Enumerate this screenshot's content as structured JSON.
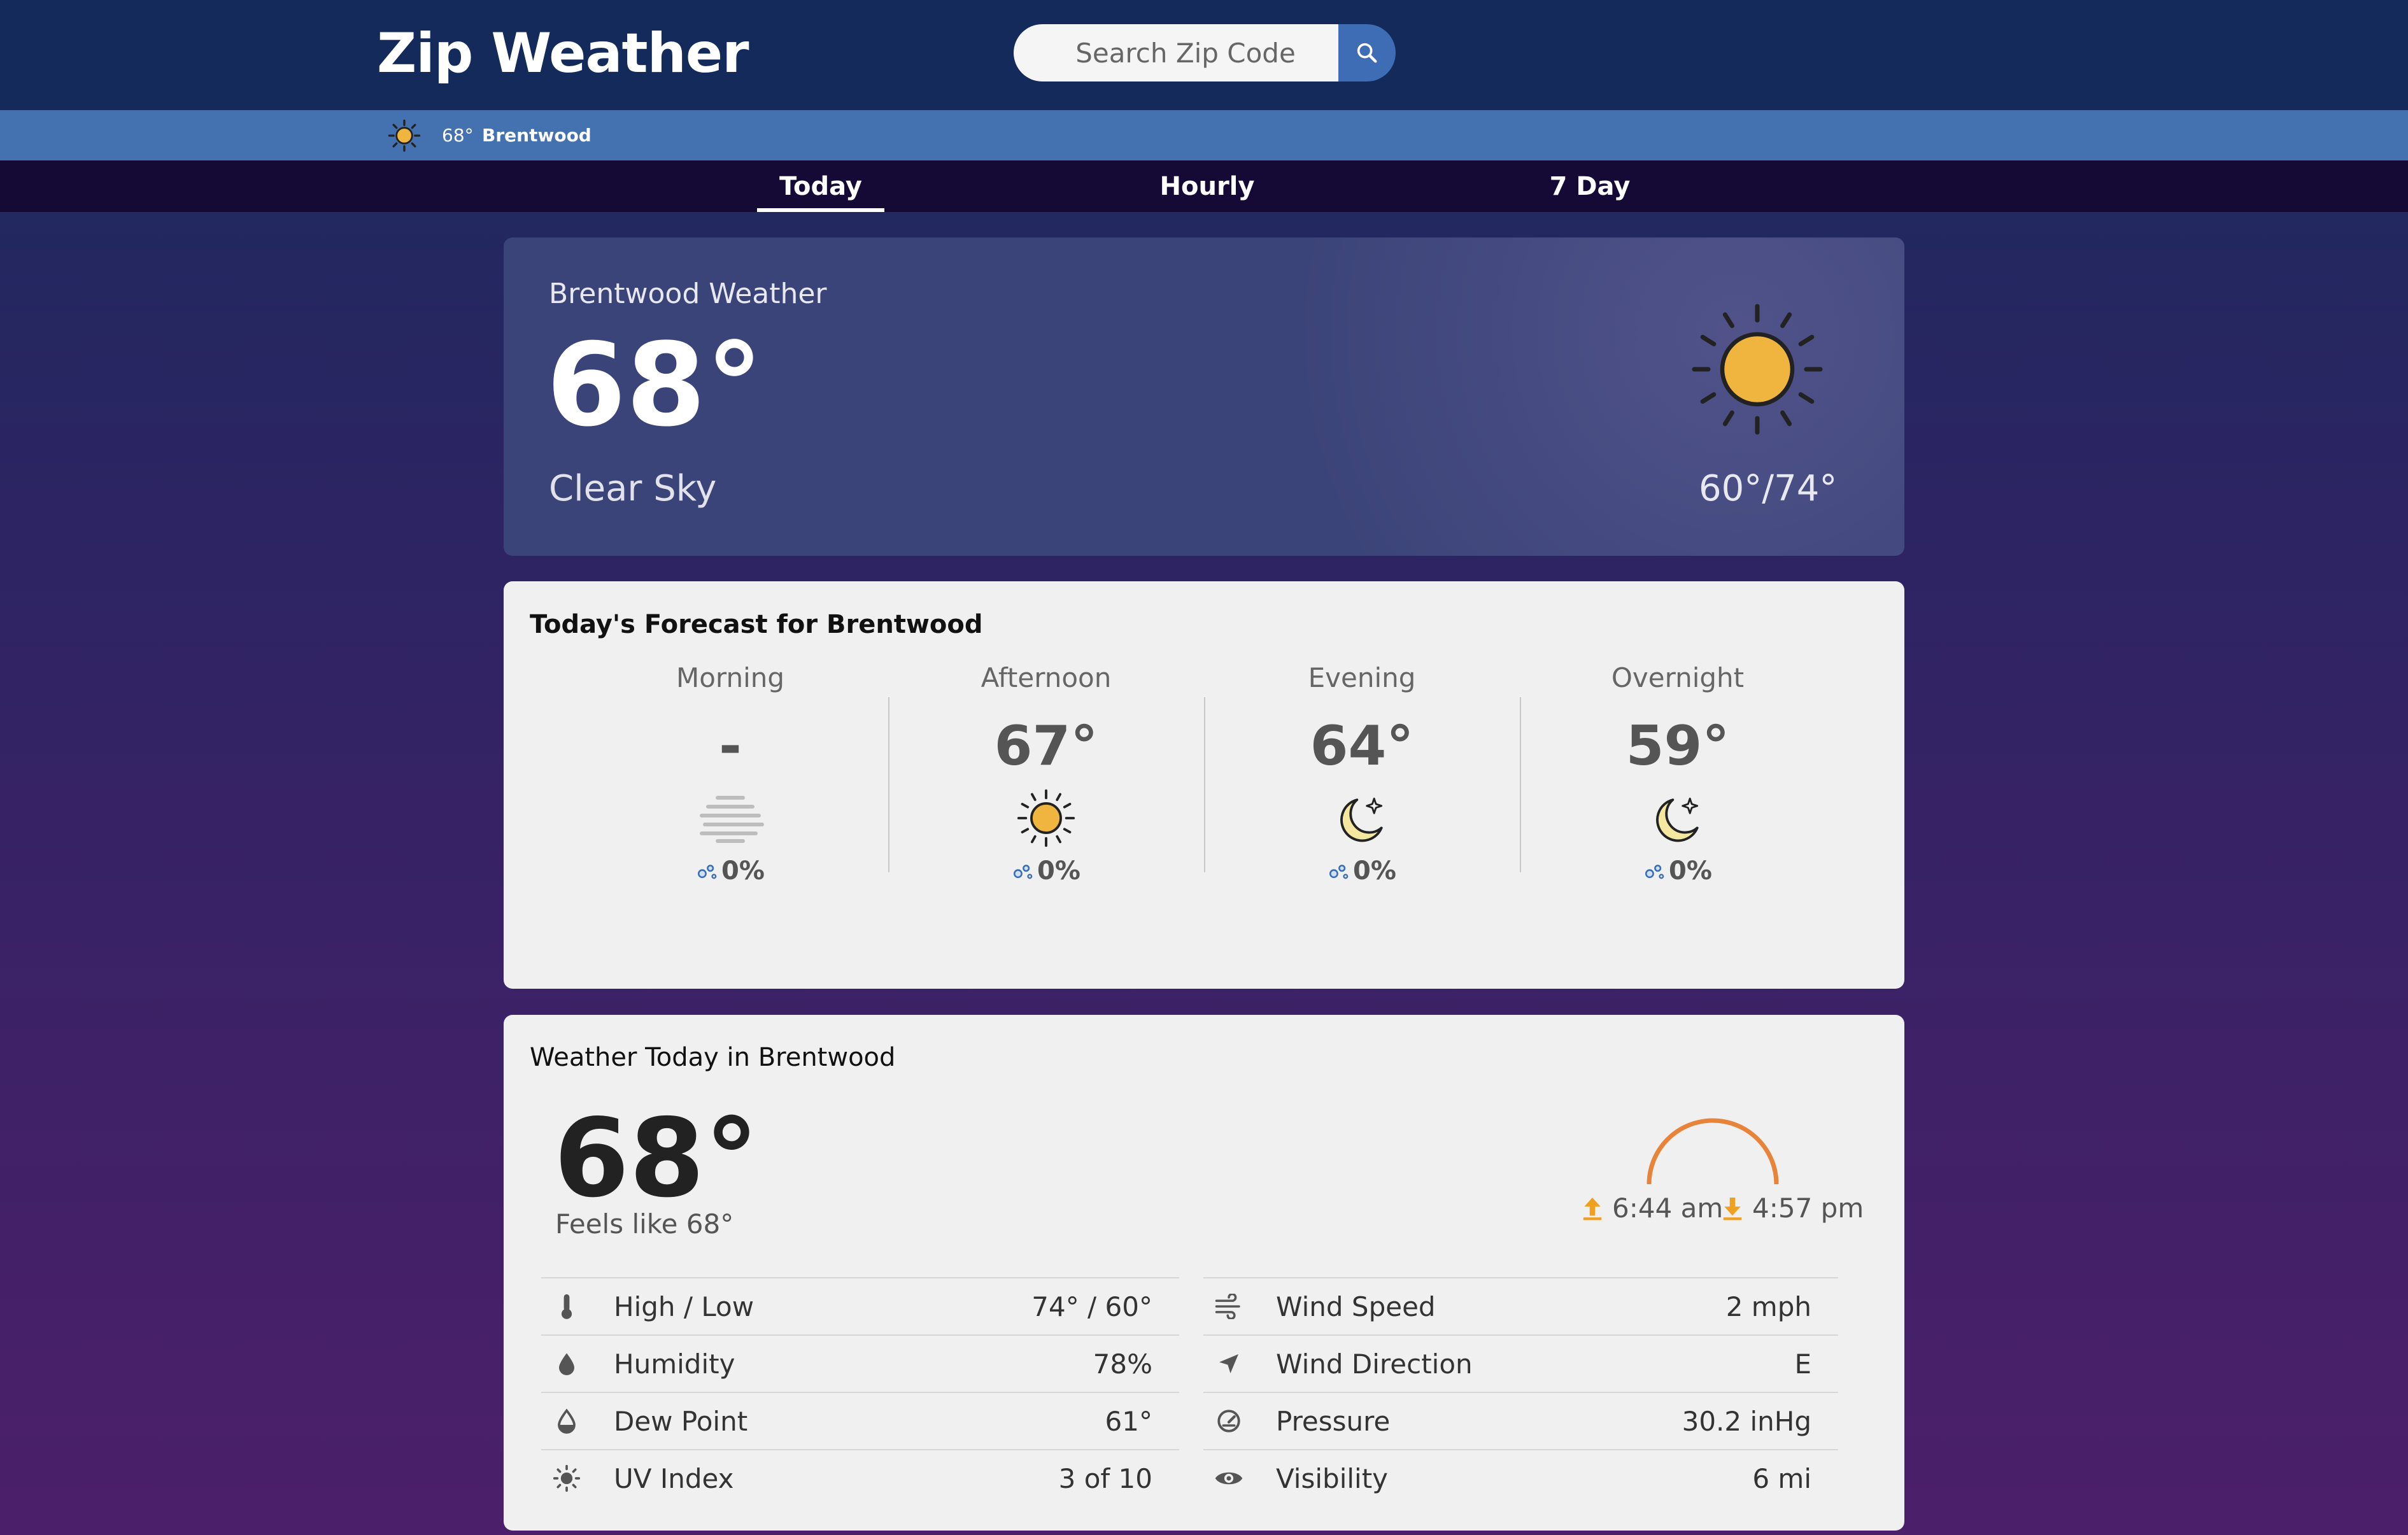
{
  "header": {
    "logo": "Zip Weather",
    "search_placeholder": "Search Zip Code"
  },
  "location_bar": {
    "temp": "68°",
    "city": "Brentwood"
  },
  "tabs": [
    {
      "label": "Today",
      "active": true
    },
    {
      "label": "Hourly",
      "active": false
    },
    {
      "label": "7 Day",
      "active": false
    }
  ],
  "hero": {
    "title": "Brentwood Weather",
    "temp": "68°",
    "condition": "Clear Sky",
    "hilo": "60°/74°",
    "icon": "sun-icon"
  },
  "forecast": {
    "title": "Today's Forecast for Brentwood",
    "periods": [
      {
        "name": "Morning",
        "temp": "-",
        "icon": "fog-icon",
        "precip": "0%"
      },
      {
        "name": "Afternoon",
        "temp": "67°",
        "icon": "sun-icon",
        "precip": "0%"
      },
      {
        "name": "Evening",
        "temp": "64°",
        "icon": "moon-icon",
        "precip": "0%"
      },
      {
        "name": "Overnight",
        "temp": "59°",
        "icon": "moon-icon",
        "precip": "0%"
      }
    ]
  },
  "today": {
    "title": "Weather Today in Brentwood",
    "temp": "68°",
    "feels_like": "Feels like 68°",
    "sunrise": "6:44 am",
    "sunset": "4:57 pm",
    "left_rows": [
      {
        "label": "High / Low",
        "value": "74° / 60°",
        "icon": "thermometer-icon"
      },
      {
        "label": "Humidity",
        "value": "78%",
        "icon": "droplet-icon"
      },
      {
        "label": "Dew Point",
        "value": "61°",
        "icon": "dew-point-icon"
      },
      {
        "label": "UV Index",
        "value": "3 of 10",
        "icon": "uv-sun-icon"
      }
    ],
    "right_rows": [
      {
        "label": "Wind Speed",
        "value": "2 mph",
        "icon": "wind-icon"
      },
      {
        "label": "Wind Direction",
        "value": "E",
        "icon": "direction-arrow-icon"
      },
      {
        "label": "Pressure",
        "value": "30.2 inHg",
        "icon": "gauge-icon"
      },
      {
        "label": "Visibility",
        "value": "6 mi",
        "icon": "eye-icon"
      }
    ]
  },
  "colors": {
    "header_bg": "#132a5b",
    "location_bar_bg": "#4472b0",
    "tabs_bg": "#150a35",
    "sun": "#f0b53e",
    "moon": "#f5e6a0",
    "sun_arc": "#e8833a",
    "sunrise_arrow": "#f0a020"
  }
}
